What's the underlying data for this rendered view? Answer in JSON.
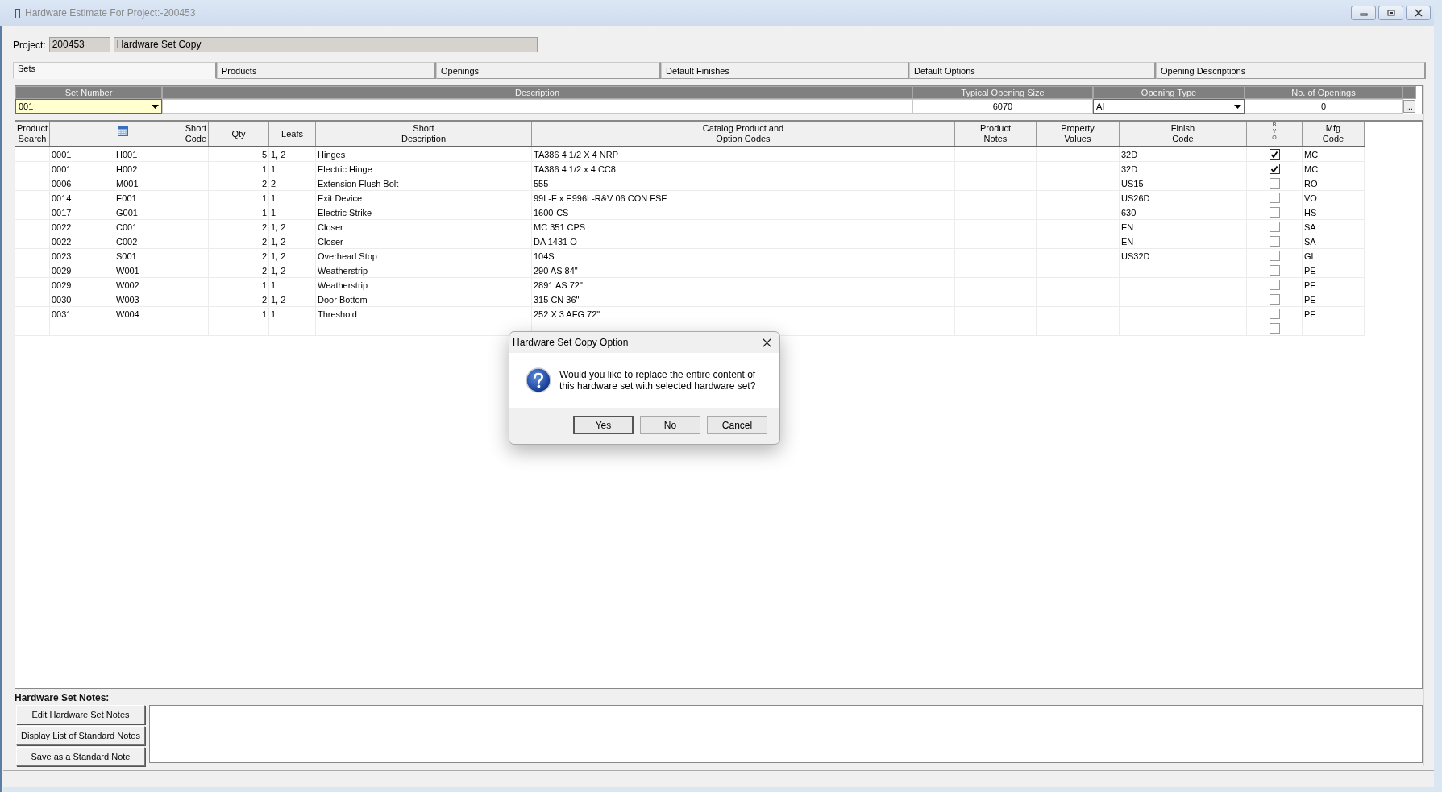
{
  "window": {
    "title": "Hardware Estimate For Project:-200453"
  },
  "project": {
    "label": "Project:",
    "number": "200453",
    "name": "Hardware Set Copy"
  },
  "tabs": [
    {
      "label": "Sets",
      "selected": true
    },
    {
      "label": "Products",
      "selected": false
    },
    {
      "label": "Openings",
      "selected": false
    },
    {
      "label": "Default Finishes",
      "selected": false
    },
    {
      "label": "Default Options",
      "selected": false
    },
    {
      "label": "Opening Descriptions",
      "selected": false
    }
  ],
  "set_header": {
    "columns": [
      "Set Number",
      "Description",
      "Typical Opening Size",
      "Opening Type",
      "No. of Openings"
    ],
    "set_number": "001",
    "typical_opening_size": "6070",
    "opening_type": "AI",
    "no_of_openings": "0",
    "more_button": "..."
  },
  "grid": {
    "columns": [
      {
        "kind": "text",
        "lines": [
          "Product",
          "Search"
        ]
      },
      {
        "kind": "blank"
      },
      {
        "kind": "calendar",
        "lines": [
          "Short",
          "Code"
        ]
      },
      {
        "kind": "text",
        "lines": [
          "Qty"
        ]
      },
      {
        "kind": "text",
        "lines": [
          "Leafs"
        ]
      },
      {
        "kind": "text",
        "lines": [
          "Short",
          "Description"
        ]
      },
      {
        "kind": "text",
        "lines": [
          "Catalog Product and",
          "Option Codes"
        ]
      },
      {
        "kind": "text",
        "lines": [
          "Product",
          "Notes"
        ]
      },
      {
        "kind": "text",
        "lines": [
          "Property",
          "Values"
        ]
      },
      {
        "kind": "text",
        "lines": [
          "Finish",
          "Code"
        ]
      },
      {
        "kind": "narrow",
        "lines": [
          "B",
          "Y",
          "O"
        ]
      },
      {
        "kind": "text",
        "lines": [
          "Mfg",
          "Code"
        ]
      }
    ],
    "rows": [
      {
        "column_2": "0001",
        "short_code": "H001",
        "qty": "5",
        "leafs": "1, 2",
        "short_description": "Hinges",
        "catalog_codes": "TA386 4 1/2 X 4 NRP",
        "finish_code": "32D",
        "byo": true,
        "mfg_code": "MC"
      },
      {
        "column_2": "0001",
        "short_code": "H002",
        "qty": "1",
        "leafs": "1",
        "short_description": "Electric Hinge",
        "catalog_codes": "TA386 4 1/2 x 4 CC8",
        "finish_code": "32D",
        "byo": true,
        "mfg_code": "MC"
      },
      {
        "column_2": "0006",
        "short_code": "M001",
        "qty": "2",
        "leafs": "2",
        "short_description": "Extension Flush Bolt",
        "catalog_codes": "555",
        "finish_code": "US15",
        "byo": false,
        "mfg_code": "RO"
      },
      {
        "column_2": "0014",
        "short_code": "E001",
        "qty": "1",
        "leafs": "1",
        "short_description": "Exit Device",
        "catalog_codes": "99L-F x E996L-R&V 06 CON FSE",
        "finish_code": "US26D",
        "byo": false,
        "mfg_code": "VO"
      },
      {
        "column_2": "0017",
        "short_code": "G001",
        "qty": "1",
        "leafs": "1",
        "short_description": "Electric Strike",
        "catalog_codes": "1600-CS",
        "finish_code": "630",
        "byo": false,
        "mfg_code": "HS"
      },
      {
        "column_2": "0022",
        "short_code": "C001",
        "qty": "2",
        "leafs": "1, 2",
        "short_description": "Closer",
        "catalog_codes": "MC 351 CPS",
        "finish_code": "EN",
        "byo": false,
        "mfg_code": "SA"
      },
      {
        "column_2": "0022",
        "short_code": "C002",
        "qty": "2",
        "leafs": "1, 2",
        "short_description": "Closer",
        "catalog_codes": "DA 1431 O",
        "finish_code": "EN",
        "byo": false,
        "mfg_code": "SA"
      },
      {
        "column_2": "0023",
        "short_code": "S001",
        "qty": "2",
        "leafs": "1, 2",
        "short_description": "Overhead Stop",
        "catalog_codes": "104S",
        "finish_code": "US32D",
        "byo": false,
        "mfg_code": "GL"
      },
      {
        "column_2": "0029",
        "short_code": "W001",
        "qty": "2",
        "leafs": "1, 2",
        "short_description": "Weatherstrip",
        "catalog_codes": "290 AS 84\"",
        "byo": false,
        "mfg_code": "PE"
      },
      {
        "column_2": "0029",
        "short_code": "W002",
        "qty": "1",
        "leafs": "1",
        "short_description": "Weatherstrip",
        "catalog_codes": "2891 AS 72\"",
        "byo": false,
        "mfg_code": "PE"
      },
      {
        "column_2": "0030",
        "short_code": "W003",
        "qty": "2",
        "leafs": "1, 2",
        "short_description": "Door Bottom",
        "catalog_codes": "315 CN 36\"",
        "byo": false,
        "mfg_code": "PE"
      },
      {
        "column_2": "0031",
        "short_code": "W004",
        "qty": "1",
        "leafs": "1",
        "short_description": "Threshold",
        "catalog_codes": "252 X 3 AFG 72\"",
        "byo": false,
        "mfg_code": "PE"
      },
      {
        "byo": false
      }
    ]
  },
  "notes": {
    "label": "Hardware Set Notes:",
    "buttons": [
      "Edit Hardware Set Notes",
      "Display List of Standard Notes",
      "Save as a Standard Note"
    ]
  },
  "dialog": {
    "title": "Hardware Set Copy Option",
    "message": "Would you like to replace the entire content of this hardware set with selected hardware set?",
    "buttons": [
      "Yes",
      "No",
      "Cancel"
    ]
  }
}
